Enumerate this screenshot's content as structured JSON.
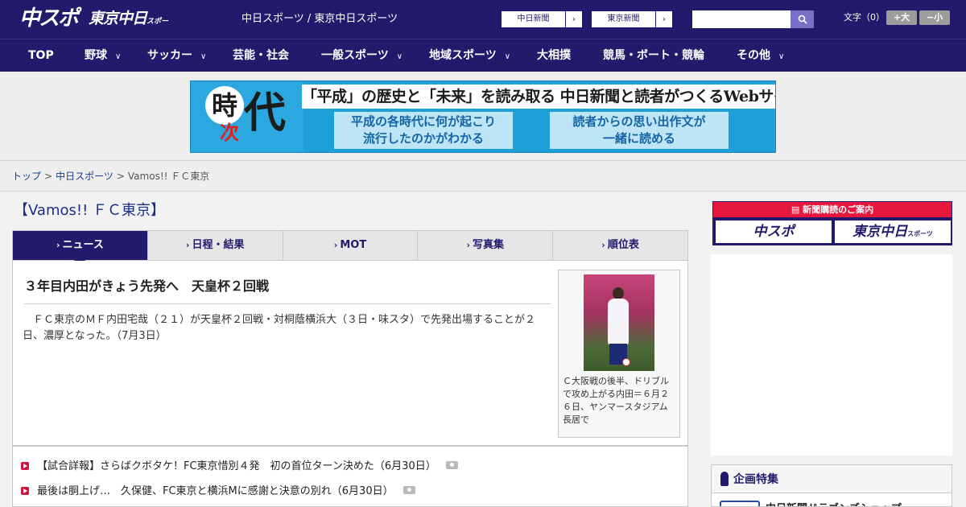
{
  "header": {
    "logo_chuspo": "中スポ",
    "logo_tokyo": "東京中日",
    "logo_tokyo_sub": "スポーツ",
    "site_name": "中日スポーツ / 東京中日スポーツ",
    "btn_chunichi": "中日新聞",
    "btn_tokyo": "東京新聞",
    "search_placeholder": "",
    "font_size_label": "文字（0）",
    "font_bigger": "+大",
    "font_smaller": "−小"
  },
  "nav": [
    {
      "label": "TOP",
      "has_menu": false
    },
    {
      "label": "野球",
      "has_menu": true
    },
    {
      "label": "サッカー",
      "has_menu": true
    },
    {
      "label": "芸能・社会",
      "has_menu": false
    },
    {
      "label": "一般スポーツ",
      "has_menu": true
    },
    {
      "label": "地域スポーツ",
      "has_menu": true
    },
    {
      "label": "大相撲",
      "has_menu": false
    },
    {
      "label": "競馬・ボート・競輪",
      "has_menu": false
    },
    {
      "label": "その他",
      "has_menu": true
    }
  ],
  "banner": {
    "logo_chars": [
      "時",
      "次",
      "代"
    ],
    "headline": "「平成」の歴史と「未来」を読み取る 中日新聞と読者がつくるWebサイト",
    "box_left": [
      "平成の各時代に何が起こり",
      "流行したのかがわかる"
    ],
    "box_right": [
      "読者からの思い出作文が",
      "一緒に読める"
    ]
  },
  "breadcrumb": {
    "home": "トップ",
    "section": "中日スポーツ",
    "current": "Vamos!! ＦＣ東京",
    "separator": ">"
  },
  "section_title": "【Vamos!! ＦＣ東京】",
  "tabs": [
    {
      "label": "ニュース",
      "active": true
    },
    {
      "label": "日程・結果",
      "active": false
    },
    {
      "label": "MOT",
      "active": false
    },
    {
      "label": "写真集",
      "active": false
    },
    {
      "label": "順位表",
      "active": false
    }
  ],
  "article": {
    "title": "３年目内田がきょう先発へ　天皇杯２回戦",
    "body": "　ＦＣ東京のＭＦ内田宅哉（２１）が天皇杯２回戦・対桐蔭横浜大（３日・味スタ）で先発出場することが２日、濃厚となった。（7月3日）",
    "photo_caption": "Ｃ大阪戦の後半、ドリブルで攻め上がる内田＝６月２６日、ヤンマースタジアム長居で"
  },
  "news": [
    {
      "text": "【試合詳報】さらばクボタケ！FC東京惜別４発　初の首位ターン決めた（6月30日）",
      "has_photo": true
    },
    {
      "text": "最後は胴上げ…　久保健、FC東京と横浜Mに感謝と決意の別れ（6月30日）",
      "has_photo": true
    }
  ],
  "sidebar": {
    "subscribe_title": "新聞購読のご案内",
    "subscribe_left": "中スポ",
    "subscribe_right": "東京中日",
    "subscribe_right_sub": "スポーツ",
    "special_title": "企画特集",
    "special_item": "中日新聞ドラゴンズショップ"
  },
  "colors": {
    "brand_navy": "#221a6b",
    "accent_red": "#e8173e",
    "search_button": "#7a6fc7"
  },
  "icons": {
    "search": "search-icon",
    "chevron": "chevron-down-icon",
    "arrow": "chevron-right-icon",
    "bullet": "play-bullet-icon",
    "photo": "camera-icon"
  }
}
